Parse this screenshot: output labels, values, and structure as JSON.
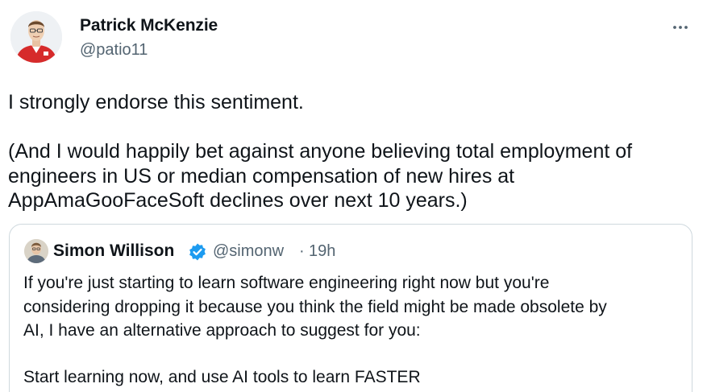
{
  "author": {
    "display_name": "Patrick McKenzie",
    "handle": "@patio11",
    "avatar_icon": "person-avatar"
  },
  "more_icon": "more-horizontal-icon",
  "tweet_text": {
    "line1": "I strongly endorse this sentiment.",
    "line2": "(And I would happily bet against anyone believing total employment of",
    "line3": "engineers in US or median compensation of new hires at",
    "line4": "AppAmaGooFaceSoft declines over next 10 years.)"
  },
  "quoted_tweet": {
    "display_name": "Simon Willison",
    "verified_icon": "verified-badge-icon",
    "verified_color": "#1d9bf0",
    "handle": "@simonw",
    "separator": "·",
    "time": "19h",
    "line1": "If you're just starting to learn software engineering right now but you're",
    "line2": "considering dropping it because you think the field might be made obsolete by",
    "line3": "AI, I have an alternative approach to suggest for you:",
    "line4": "Start learning now, and use AI tools to learn FASTER"
  },
  "colors": {
    "text_primary": "#0f1419",
    "text_secondary": "#536471",
    "border": "#cfd9de"
  }
}
